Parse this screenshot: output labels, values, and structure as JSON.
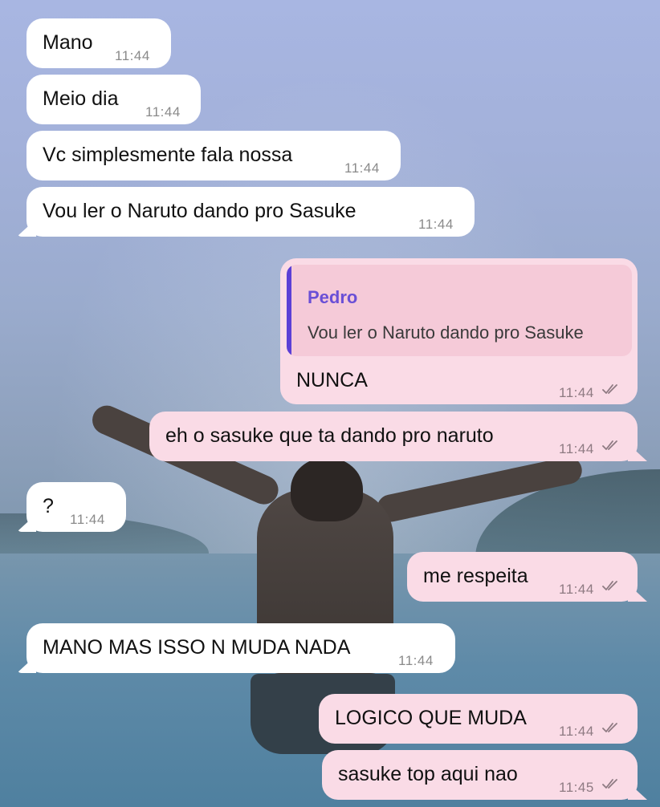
{
  "colors": {
    "incoming_bubble": "#ffffff",
    "outgoing_bubble": "#fadbe6",
    "reply_accent": "#5b3fd6"
  },
  "messages": [
    {
      "text": "Mano",
      "time": "11:44"
    },
    {
      "text": "Meio dia",
      "time": "11:44"
    },
    {
      "text": "Vc simplesmente fala nossa",
      "time": "11:44"
    },
    {
      "text": "Vou ler o Naruto dando pro Sasuke",
      "time": "11:44"
    },
    {
      "text": "NUNCA",
      "time": "11:44",
      "status_icon": "double-check-icon",
      "reply": {
        "author": "Pedro",
        "text": "Vou ler o Naruto dando pro Sasuke"
      }
    },
    {
      "text": "eh o sasuke que ta dando pro naruto",
      "time": "11:44",
      "status_icon": "double-check-icon"
    },
    {
      "text": "?",
      "time": "11:44"
    },
    {
      "text": "me respeita",
      "time": "11:44",
      "status_icon": "double-check-icon"
    },
    {
      "text": "MANO MAS ISSO N MUDA NADA",
      "time": "11:44"
    },
    {
      "text": "LOGICO QUE MUDA",
      "time": "11:44",
      "status_icon": "double-check-icon"
    },
    {
      "text": "sasuke top aqui nao",
      "time": "11:45",
      "status_icon": "double-check-icon"
    }
  ]
}
